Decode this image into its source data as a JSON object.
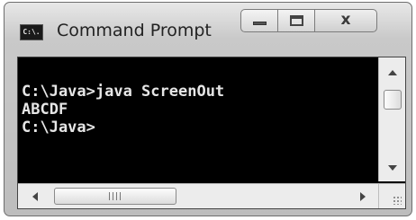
{
  "window": {
    "title": "Command Prompt",
    "icon_label": "C:\\.",
    "controls": {
      "minimize_icon": "minimize-icon",
      "maximize_icon": "maximize-icon",
      "close_icon": "close-icon",
      "close_glyph": "x"
    }
  },
  "console": {
    "lines": [
      "C:\\Java>java ScreenOut",
      "ABCDF",
      "C:\\Java>"
    ],
    "background": "#000000",
    "text_color": "#e6e6e6"
  },
  "scrollbars": {
    "vertical_icons": [
      "up-arrow-icon",
      "down-arrow-icon"
    ],
    "horizontal_icons": [
      "left-arrow-icon",
      "right-arrow-icon"
    ]
  }
}
